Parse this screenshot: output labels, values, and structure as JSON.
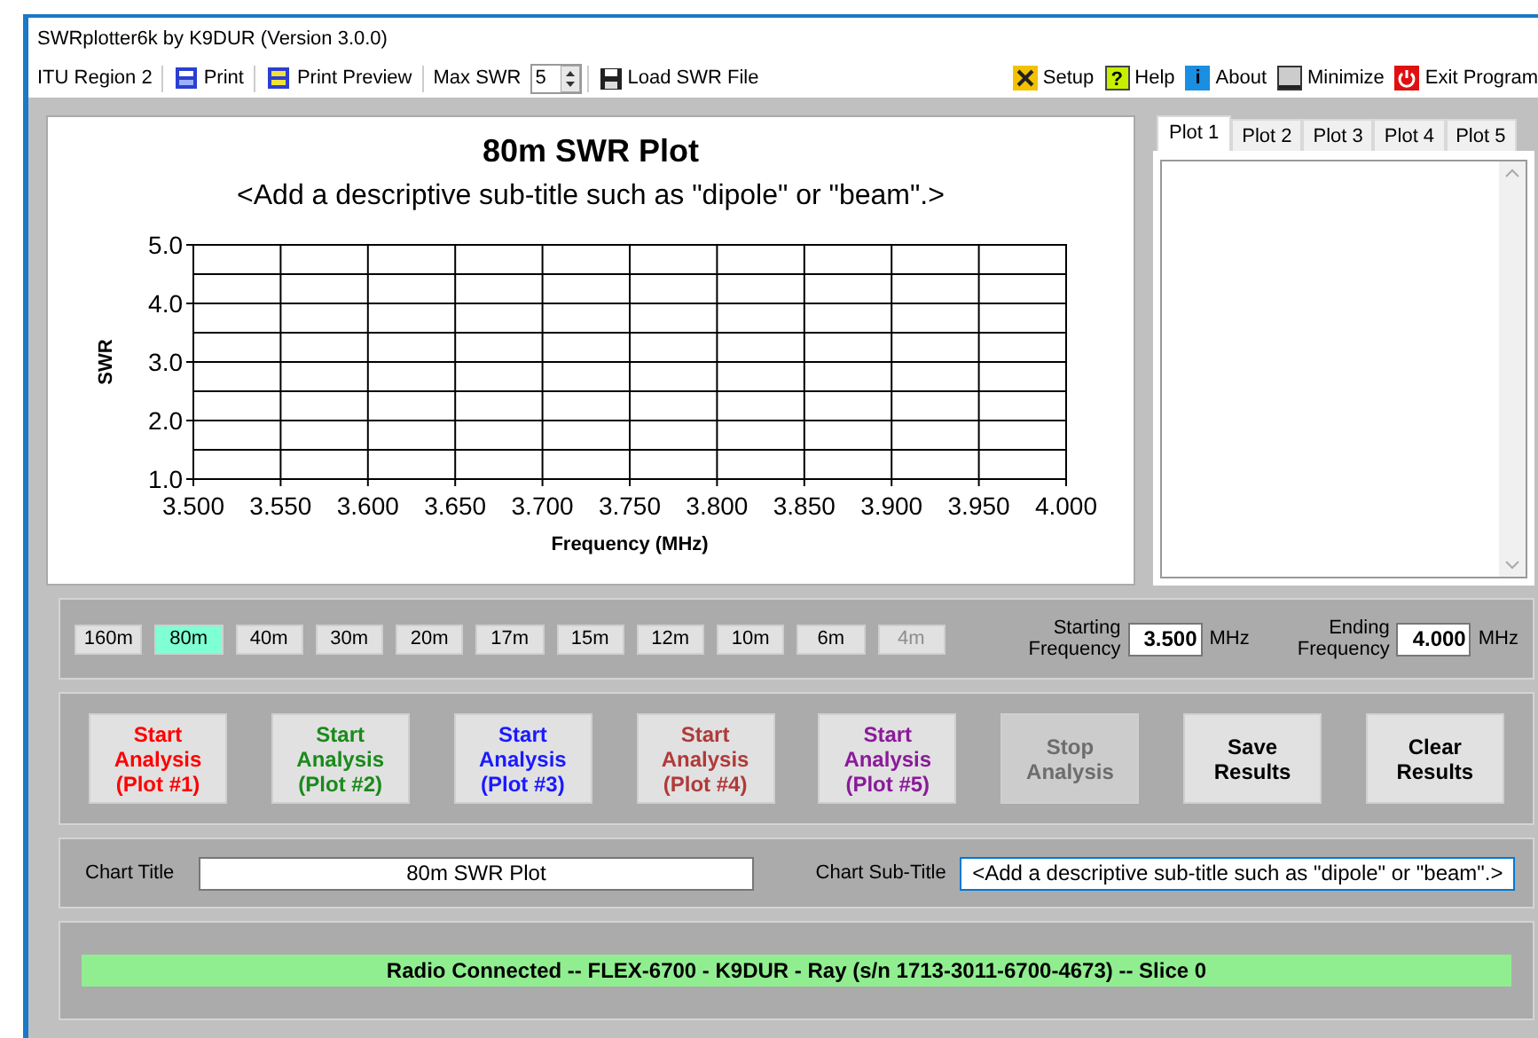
{
  "window": {
    "title": "SWRplotter6k by K9DUR (Version 3.0.0)"
  },
  "toolbar": {
    "left": [
      {
        "kind": "label",
        "label": "ITU Region 2"
      },
      {
        "kind": "print",
        "label": "Print"
      },
      {
        "kind": "preview",
        "label": "Print Preview"
      },
      {
        "kind": "spinner",
        "label": "Max SWR",
        "value": "5"
      },
      {
        "kind": "load",
        "label": "Load SWR File"
      }
    ],
    "right": [
      {
        "label": "Setup"
      },
      {
        "label": "Help",
        "glyph": "?"
      },
      {
        "label": "About",
        "glyph": "i"
      },
      {
        "label": "Minimize"
      },
      {
        "label": "Exit Program"
      }
    ]
  },
  "chart": {
    "subtitle": "<Add a descriptive sub-title such as \"dipole\" or \"beam\".>",
    "chart_data": {
      "type": "line",
      "grid": true,
      "title": "80m SWR Plot",
      "xlabel": "Frequency (MHz)",
      "ylabel": "SWR",
      "xlim": [
        3.5,
        4.0
      ],
      "ylim": [
        1.0,
        5.0
      ],
      "xticks": [
        {
          "value": 3.5,
          "label": "3.500"
        },
        {
          "value": 3.55,
          "label": "3.550"
        },
        {
          "value": 3.6,
          "label": "3.600"
        },
        {
          "value": 3.65,
          "label": "3.650"
        },
        {
          "value": 3.7,
          "label": "3.700"
        },
        {
          "value": 3.75,
          "label": "3.750"
        },
        {
          "value": 3.8,
          "label": "3.800"
        },
        {
          "value": 3.85,
          "label": "3.850"
        },
        {
          "value": 3.9,
          "label": "3.900"
        },
        {
          "value": 3.95,
          "label": "3.950"
        },
        {
          "value": 4.0,
          "label": "4.000"
        }
      ],
      "yticks": [
        {
          "value": 1,
          "label": "1.0"
        },
        {
          "value": 2,
          "label": "2.0"
        },
        {
          "value": 3,
          "label": "3.0"
        },
        {
          "value": 4,
          "label": "4.0"
        },
        {
          "value": 5,
          "label": "5.0"
        }
      ]
    }
  },
  "plot_tabs": [
    {
      "label": "Plot 1",
      "selected": true
    },
    {
      "label": "Plot 2",
      "selected": false
    },
    {
      "label": "Plot 3",
      "selected": false
    },
    {
      "label": "Plot 4",
      "selected": false
    },
    {
      "label": "Plot 5",
      "selected": false
    }
  ],
  "bands": [
    {
      "label": "160m",
      "selected": false,
      "disabled": false
    },
    {
      "label": "80m",
      "selected": true,
      "disabled": false
    },
    {
      "label": "40m",
      "selected": false,
      "disabled": false
    },
    {
      "label": "30m",
      "selected": false,
      "disabled": false
    },
    {
      "label": "20m",
      "selected": false,
      "disabled": false
    },
    {
      "label": "17m",
      "selected": false,
      "disabled": false
    },
    {
      "label": "15m",
      "selected": false,
      "disabled": false
    },
    {
      "label": "12m",
      "selected": false,
      "disabled": false
    },
    {
      "label": "10m",
      "selected": false,
      "disabled": false
    },
    {
      "label": "6m",
      "selected": false,
      "disabled": false
    },
    {
      "label": "4m",
      "selected": false,
      "disabled": true
    }
  ],
  "frequency": [
    {
      "label": "Starting Frequency",
      "value": "3.500",
      "unit": "MHz"
    },
    {
      "label": "Ending Frequency",
      "value": "4.000",
      "unit": "MHz"
    }
  ],
  "actions": [
    {
      "lines": [
        "Start",
        "Analysis",
        "(Plot #1)"
      ],
      "color": "#ff0000",
      "disabled": false
    },
    {
      "lines": [
        "Start",
        "Analysis",
        "(Plot #2)"
      ],
      "color": "#1a8a1a",
      "disabled": false
    },
    {
      "lines": [
        "Start",
        "Analysis",
        "(Plot #3)"
      ],
      "color": "#1a1aff",
      "disabled": false
    },
    {
      "lines": [
        "Start",
        "Analysis",
        "(Plot #4)"
      ],
      "color": "#b03a3a",
      "disabled": false
    },
    {
      "lines": [
        "Start",
        "Analysis",
        "(Plot #5)"
      ],
      "color": "#8a1a9a",
      "disabled": false
    },
    {
      "lines": [
        "Stop",
        "Analysis"
      ],
      "color": "#6d6d6d",
      "disabled": true
    },
    {
      "lines": [
        "Save",
        "Results"
      ],
      "color": "#000000",
      "disabled": false
    },
    {
      "lines": [
        "Clear",
        "Results"
      ],
      "color": "#000000",
      "disabled": false
    }
  ],
  "titles": [
    {
      "label": "Chart Title",
      "value": "80m SWR Plot",
      "focused": false
    },
    {
      "label": "Chart Sub-Title",
      "value": "<Add a descriptive sub-title such as \"dipole\" or \"beam\".>",
      "focused": true
    }
  ],
  "status_bar": {
    "text": "Radio Connected -- FLEX-6700 - K9DUR - Ray  (s/n 1713-3011-6700-4673) -- Slice 0"
  }
}
